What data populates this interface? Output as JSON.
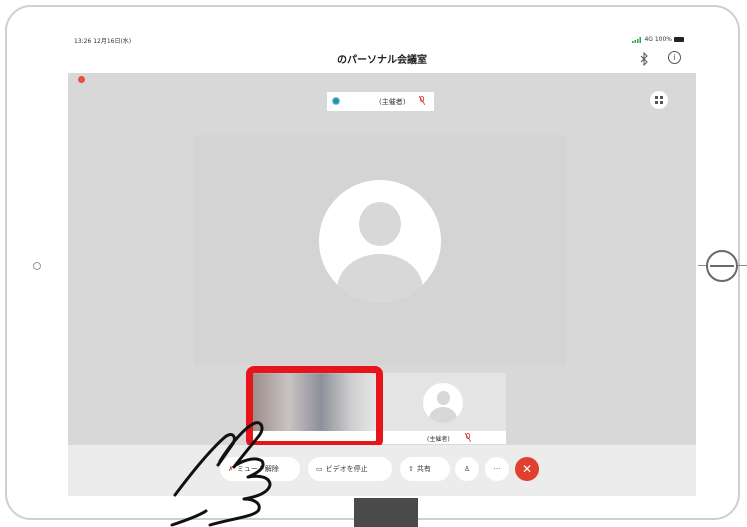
{
  "status": {
    "time": "13:26  12月16日(水)",
    "network": "4G 100%"
  },
  "header": {
    "title": "のパーソナル会議室"
  },
  "host_pill": {
    "label": "(主催者)"
  },
  "thumbnails": [
    {
      "name": "",
      "label": ""
    },
    {
      "name": "",
      "label": "(主催者)"
    }
  ],
  "toolbar": {
    "mute_label": "ミュート解除",
    "video_label": "ビデオを停止",
    "share_label": "共有",
    "more_label": "···",
    "leave_label": "✕"
  },
  "colors": {
    "accent_red": "#e0402e",
    "highlight": "#e8141b",
    "screen_bg": "#d8d8d8"
  },
  "icons": [
    "bluetooth-icon",
    "info-icon",
    "grid-view-icon",
    "mic-muted-icon",
    "video-icon",
    "share-icon",
    "participants-icon",
    "more-icon",
    "leave-icon",
    "hand-pointer-icon"
  ]
}
